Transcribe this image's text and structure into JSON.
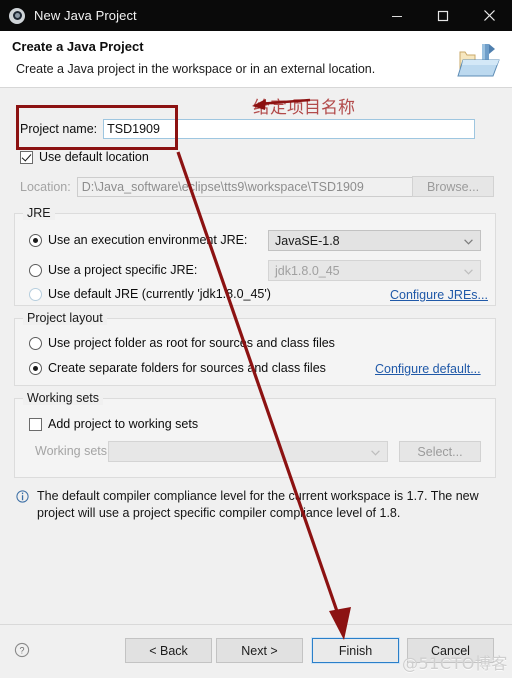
{
  "window": {
    "title": "New Java Project",
    "icon": "eclipse-java-project-icon",
    "controls": {
      "minimize": "minimize-icon",
      "maximize": "maximize-icon",
      "close": "close-icon"
    }
  },
  "header": {
    "title": "Create a Java Project",
    "description": "Create a Java project in the workspace or in an external location.",
    "icon": "new-java-project-wizard-icon"
  },
  "form": {
    "project_name_label": "Project name:",
    "project_name_value": "TSD1909",
    "use_default_location_label": "Use default location",
    "use_default_location_checked": true,
    "location_label": "Location:",
    "location_value": "D:\\Java_software\\eclipse\\tts9\\workspace\\TSD1909",
    "browse_label": "Browse...",
    "browse_enabled": false
  },
  "jre": {
    "group_title": "JRE",
    "options": [
      {
        "label": "Use an execution environment JRE:",
        "selected": true
      },
      {
        "label": "Use a project specific JRE:",
        "selected": false
      },
      {
        "label": "Use default JRE (currently 'jdk1.8.0_45')",
        "selected": false
      }
    ],
    "execution_env_value": "JavaSE-1.8",
    "project_jre_value": "jdk1.8.0_45",
    "configure_link": "Configure JREs..."
  },
  "layout": {
    "group_title": "Project layout",
    "options": [
      {
        "label": "Use project folder as root for sources and class files",
        "selected": false
      },
      {
        "label": "Create separate folders for sources and class files",
        "selected": true
      }
    ],
    "configure_link": "Configure default..."
  },
  "working_sets": {
    "group_title": "Working sets",
    "add_label": "Add project to working sets",
    "add_checked": false,
    "sets_label": "Working sets:",
    "sets_value": "",
    "select_label": "Select..."
  },
  "info": {
    "icon": "info-icon",
    "message": "The default compiler compliance level for the current workspace is 1.7. The new project will use a project specific compiler compliance level of 1.8."
  },
  "buttons": {
    "help": "help-icon",
    "back": "< Back",
    "next": "Next >",
    "finish": "Finish",
    "cancel": "Cancel"
  },
  "annotations": {
    "callout_text": "给定项目名称",
    "callout_color": "#b24a4a",
    "highlight_color": "#8c1212",
    "arrow_color": "#8c1212",
    "watermark": "@51CTO博客"
  }
}
